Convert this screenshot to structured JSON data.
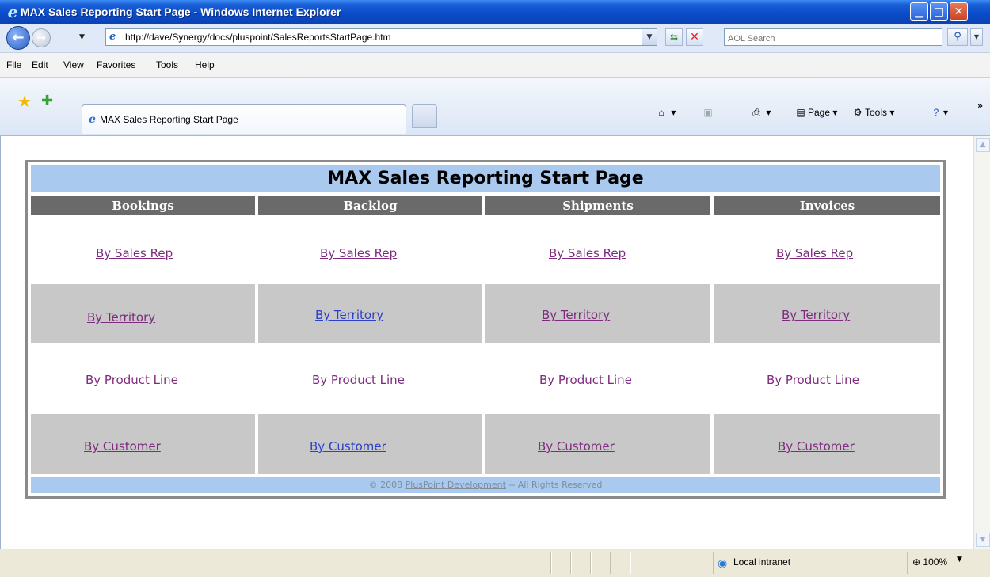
{
  "window": {
    "title": "MAX Sales Reporting Start Page - Windows Internet Explorer"
  },
  "address": {
    "url": "http://dave/Synergy/docs/pluspoint/SalesReportsStartPage.htm",
    "search_placeholder": "AOL Search"
  },
  "menu": [
    "File",
    "Edit",
    "View",
    "Favorites",
    "Tools",
    "Help"
  ],
  "tab": {
    "label": "MAX Sales Reporting Start Page"
  },
  "commands": {
    "page": "Page",
    "tools": "Tools"
  },
  "report": {
    "title": "MAX Sales Reporting Start Page",
    "columns": [
      "Bookings",
      "Backlog",
      "Shipments",
      "Invoices"
    ],
    "rows": [
      [
        "By Sales Rep",
        "By Sales Rep",
        "By Sales Rep",
        "By Sales Rep"
      ],
      [
        "By Territory",
        "By Territory",
        "By Territory",
        "By Territory"
      ],
      [
        "By Product Line",
        "By Product Line",
        "By Product Line",
        "By Product Line"
      ],
      [
        "By Customer",
        "By Customer",
        "By Customer",
        "By Customer"
      ]
    ],
    "footer": {
      "prefix": "© 2008 ",
      "link": "PlusPoint Development",
      "suffix": " -- All Rights Reserved"
    }
  },
  "status": {
    "zone": "Local intranet",
    "zoom": "100%"
  }
}
